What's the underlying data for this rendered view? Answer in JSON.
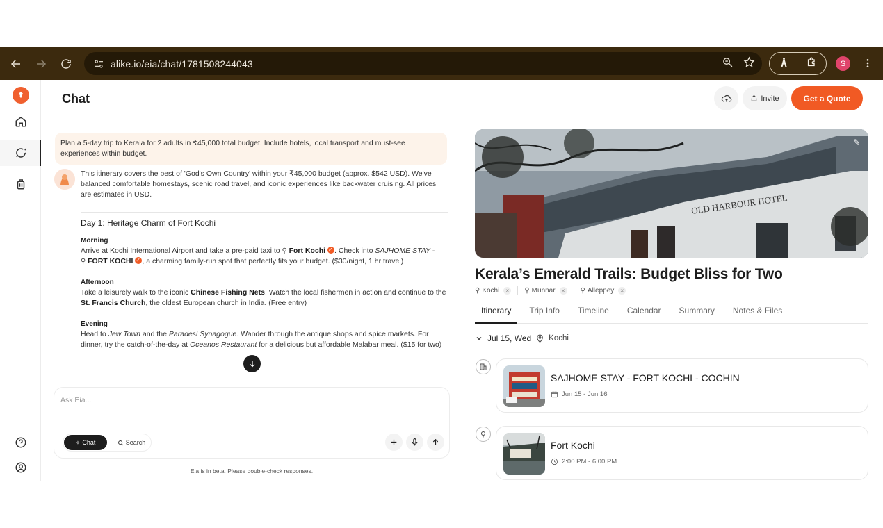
{
  "browser": {
    "url": "alike.io/eia/chat/1781508244043",
    "profile_initial": "S"
  },
  "header": {
    "title": "Chat",
    "invite_label": "Invite",
    "quote_label": "Get a Quote"
  },
  "chat": {
    "user_message": "Plan a 5-day trip to Kerala for 2 adults in ₹45,000 total budget. Include hotels, local transport and must-see experiences within budget.",
    "bot_intro": "This itinerary covers the best of 'God's Own Country' within your ₹45,000 budget (approx. $542 USD). We've balanced comfortable homestays, scenic road travel, and iconic experiences like backwater cruising. All prices are estimates in USD.",
    "day_title": "Day 1: Heritage Charm of Fort Kochi",
    "morning": {
      "heading": "Morning",
      "t1": "Arrive at Kochi International Airport and take a pre-paid taxi to ",
      "place1": "Fort Kochi",
      "t2": ". Check into ",
      "hotel_italic": "SAJHOME STAY -",
      "place2": "FORT KOCHI",
      "t3": ", a charming family-run spot that perfectly fits your budget. ($30/night, 1 hr travel)"
    },
    "afternoon": {
      "heading": "Afternoon",
      "t1": "Take a leisurely walk to the iconic ",
      "b1": "Chinese Fishing Nets",
      "t2": ". Watch the local fishermen in action and continue to the ",
      "b2": "St. Francis Church",
      "t3": ", the oldest European church in India. (Free entry)"
    },
    "evening": {
      "heading": "Evening",
      "t1": "Head to ",
      "i1": "Jew Town",
      "t2": " and the ",
      "i2": "Paradesi Synagogue",
      "t3": ". Wander through the antique shops and spice markets. For dinner, try the catch-of-the-day at ",
      "i3": "Oceanos Restaurant",
      "t4": " for a delicious but affordable Malabar meal. ($15 for two)"
    },
    "input_placeholder": "Ask Eia...",
    "mode_chat": "Chat",
    "mode_search": "Search",
    "beta_note": "Eia is in beta. Please double-check responses."
  },
  "trip": {
    "title": "Kerala’s Emerald Trails: Budget Bliss for Two",
    "hero_sign": "OLD HARBOUR HOTEL",
    "locations": [
      "Kochi",
      "Munnar",
      "Alleppey"
    ],
    "tabs": [
      "Itinerary",
      "Trip Info",
      "Timeline",
      "Calendar",
      "Summary",
      "Notes & Files"
    ],
    "day_label": "Jul 15, Wed",
    "day_location": "Kochi",
    "items": [
      {
        "title": "SAJHOME STAY - FORT KOCHI - COCHIN",
        "meta": "Jun 15 - Jun 16"
      },
      {
        "title": "Fort Kochi",
        "meta": "2:00 PM - 6:00 PM"
      }
    ]
  },
  "colors": {
    "accent": "#f15a24",
    "chrome": "#3c2a0e",
    "user_bubble": "#fdf3ea"
  }
}
